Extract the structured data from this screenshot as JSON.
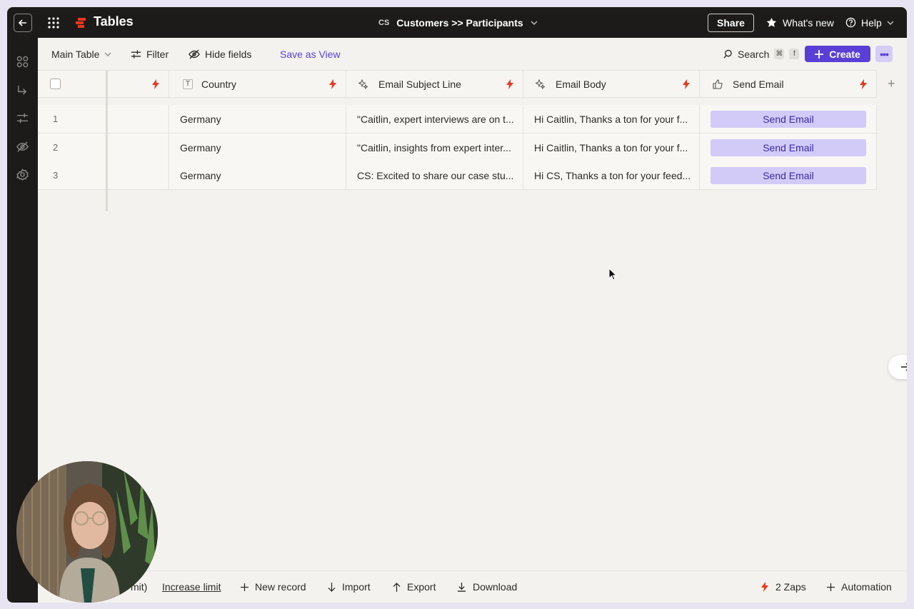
{
  "app": {
    "title": "Tables"
  },
  "breadcrumb": {
    "badge": "CS",
    "text": "Customers >> Participants"
  },
  "topbar": {
    "share": "Share",
    "whats_new": "What's new",
    "help": "Help"
  },
  "toolbar": {
    "view": "Main Table",
    "filter": "Filter",
    "hide_fields": "Hide fields",
    "save_as_view": "Save as View",
    "search": "Search",
    "shortcut_cmd": "⌘",
    "shortcut_key": "f",
    "create": "Create"
  },
  "columns": [
    {
      "name": "Country",
      "type_icon": "T"
    },
    {
      "name": "Email Subject Line",
      "type_icon": "ai-sparkle"
    },
    {
      "name": "Email Body",
      "type_icon": "ai-sparkle"
    },
    {
      "name": "Send Email",
      "type_icon": "thumbs-up"
    }
  ],
  "rows": [
    {
      "num": "1",
      "country": "Germany",
      "subject": "\"Caitlin, expert interviews are on t...",
      "body": "Hi Caitlin, Thanks a ton for your f...",
      "action": "Send Email"
    },
    {
      "num": "2",
      "country": "Germany",
      "subject": "\"Caitlin, insights from expert inter...",
      "body": "Hi Caitlin, Thanks a ton for your f...",
      "action": "Send Email"
    },
    {
      "num": "3",
      "country": "Germany",
      "subject": "CS: Excited to share our case stu...",
      "body": "Hi CS, Thanks a ton for your feed...",
      "action": "Send Email"
    }
  ],
  "footer": {
    "limit_fragment": "mit)",
    "increase_limit": "Increase limit",
    "new_record": "New record",
    "import": "Import",
    "export": "Export",
    "download": "Download",
    "zaps": "2 Zaps",
    "automation": "Automation"
  },
  "colors": {
    "accent": "#5a3fd6",
    "accent_light": "#d2cbf8",
    "bolt": "#e8371f",
    "chrome": "#1c1b19"
  }
}
